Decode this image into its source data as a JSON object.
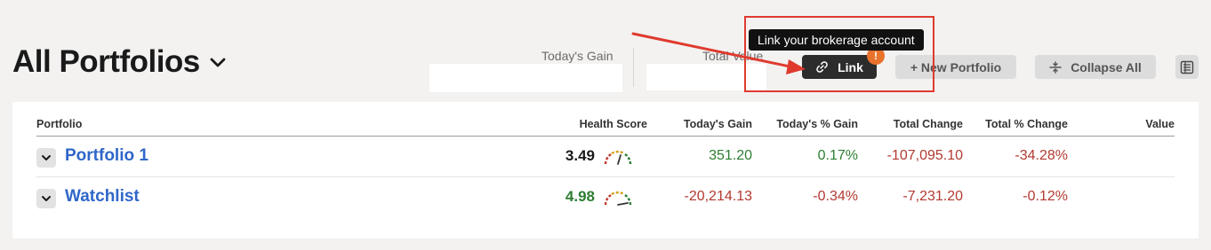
{
  "header": {
    "title": "All Portfolios",
    "todays_gain_label": "Today's Gain",
    "total_value_label": "Total Value"
  },
  "toolbar": {
    "link_label": "Link",
    "link_alert": "!",
    "new_portfolio_label": "+ New Portfolio",
    "collapse_all_label": "Collapse All"
  },
  "tooltip": {
    "text": "Link your brokerage account"
  },
  "table": {
    "columns": [
      "Portfolio",
      "Health Score",
      "Today's Gain",
      "Today's % Gain",
      "Total Change",
      "Total % Change",
      "Value"
    ],
    "rows": [
      {
        "name": "Portfolio 1",
        "health_score": "3.49",
        "todays_gain": "351.20",
        "todays_pct_gain": "0.17%",
        "total_change": "-107,095.10",
        "total_pct_change": "-34.28%",
        "value": ""
      },
      {
        "name": "Watchlist",
        "health_score": "4.98",
        "todays_gain": "-20,214.13",
        "todays_pct_gain": "-0.34%",
        "total_change": "-7,231.20",
        "total_pct_change": "-0.12%",
        "value": ""
      }
    ]
  },
  "colors": {
    "positive": "#2e7d32",
    "negative": "#b23a30",
    "link_blue": "#2f66c9",
    "annotation_red": "#e03a2e",
    "alert_orange": "#e8722c"
  },
  "icons": [
    "chevron-down-icon",
    "link-icon",
    "collapse-icon",
    "view-toggle-icon",
    "gauge-icon"
  ]
}
